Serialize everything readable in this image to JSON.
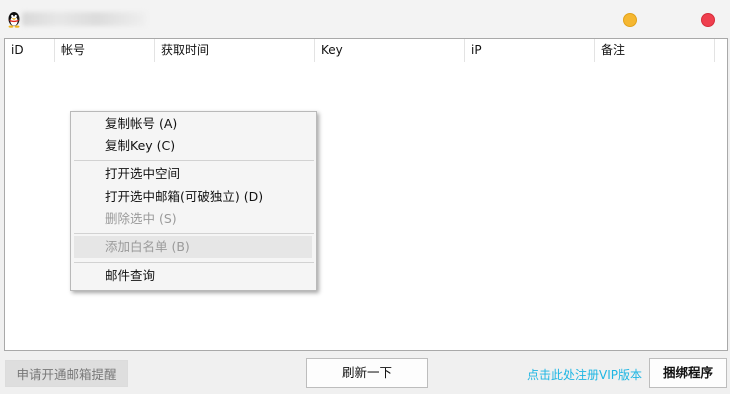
{
  "window": {
    "controls": {
      "minimize_color": "#f5b731",
      "close_color": "#ef3f4e"
    }
  },
  "table": {
    "columns": [
      "iD",
      "帐号",
      "获取时间",
      "Key",
      "iP",
      "备注"
    ]
  },
  "context_menu": {
    "items": [
      {
        "label": "复制帐号 (A)",
        "disabled": false
      },
      {
        "label": "复制Key (C)",
        "disabled": false
      },
      {
        "label": "打开选中空间",
        "disabled": false
      },
      {
        "label": "打开选中邮箱(可破独立) (D)",
        "disabled": false
      },
      {
        "label": "删除选中 (S)",
        "disabled": true
      },
      {
        "label": "添加白名单 (B)",
        "disabled": true,
        "highlighted": true
      },
      {
        "label": "邮件查询",
        "disabled": false
      }
    ]
  },
  "footer": {
    "apply_button": "申请开通邮箱提醒",
    "refresh_button": "刷新一下",
    "vip_link": "点击此处注册VIP版本",
    "bundle_button": "捆绑程序",
    "vip_link_color": "#1fb6e3"
  }
}
